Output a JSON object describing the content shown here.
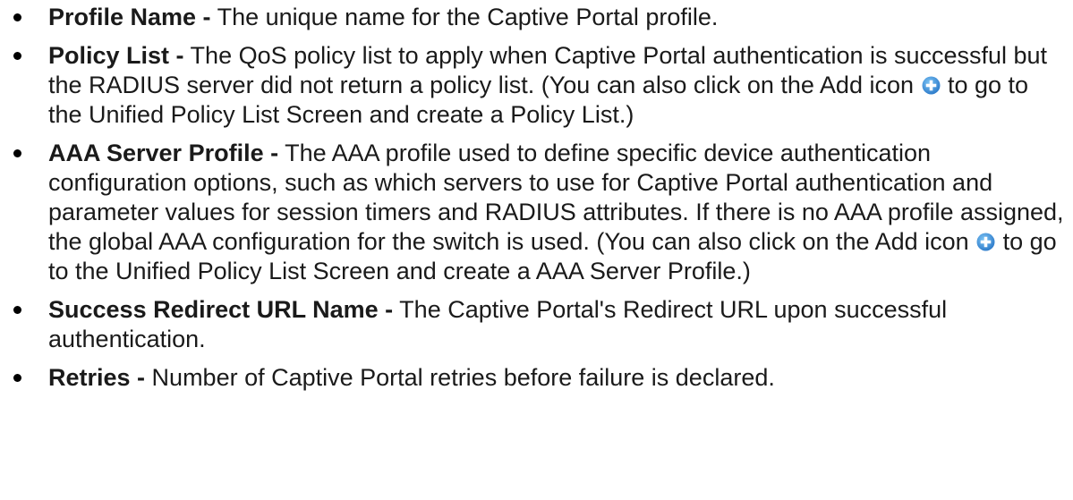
{
  "items": [
    {
      "term": "Profile Name -",
      "text": " The unique name for the Captive Portal profile."
    },
    {
      "term": "Policy List -",
      "text_before_icon": " The QoS policy list to apply when Captive Portal authentication is successful but the RADIUS server did not return a policy list. (You can also click on the Add icon ",
      "text_after_icon": " to go to the Unified Policy List Screen and create a Policy List.)",
      "icon": "add-icon"
    },
    {
      "term": "AAA Server Profile -",
      "text_before_icon": " The AAA profile used to define specific device authentication configuration options, such as which servers to use for Captive Portal authentication and parameter values for session timers and RADIUS attributes. If there is no AAA profile assigned, the global AAA configuration for the switch is used. (You can also click on the Add icon ",
      "text_after_icon": " to go to the Unified Policy List Screen and create a AAA Server Profile.)",
      "icon": "add-icon"
    },
    {
      "term": "Success Redirect URL Name -",
      "text": " The Captive Portal's Redirect URL upon successful authentication."
    },
    {
      "term": "Retries -",
      "text": " Number of Captive Portal retries before failure is declared."
    }
  ],
  "colors": {
    "text": "#1a1a1a",
    "add_icon_fill": "#3a8fd8"
  }
}
